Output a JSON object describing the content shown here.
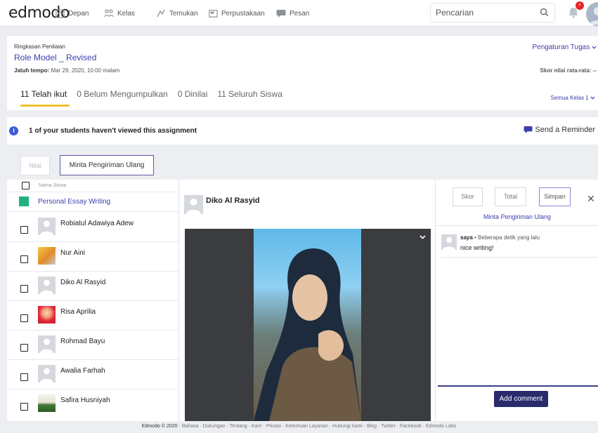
{
  "nav": {
    "logo": "edmodo",
    "links": [
      "Depan",
      "Kelas",
      "Temukan",
      "Perpustakaan",
      "Pesan"
    ],
    "search_placeholder": "Pencarian",
    "notification_count": "•"
  },
  "assignment": {
    "summary_label": "Ringkasan Penilaian",
    "title": "Role Model _ Revised",
    "due_label": "Jatuh tempo:",
    "due_value": "Mar 29, 2020, 10:00 malam",
    "settings_link": "Pengaturan Tugas",
    "avg_label": "Skor nilai rata-rata: --",
    "tabs": [
      "11 Telah ikut",
      "0 Belum Mengumpulkan",
      "0 Dinilai",
      "11 Seluruh Siswa"
    ],
    "class_filter": "Semua Kelas 1"
  },
  "notice": {
    "message": "1 of your students haven't viewed this assignment",
    "reminder": "Send a Reminder"
  },
  "actions": {
    "grade": "Nilai",
    "request_resubmission": "Minta Pengiriman Ulang"
  },
  "students": {
    "header": "Nama Siswa",
    "group": "Personal Essay Writing",
    "rows": [
      {
        "name": "Robiatul Adawiya Adew",
        "avatar": "default"
      },
      {
        "name": "Nur Aini",
        "avatar": "photo-yellow"
      },
      {
        "name": "Diko Al Rasyid",
        "avatar": "default"
      },
      {
        "name": "Risa Aprilia",
        "avatar": "photo-red"
      },
      {
        "name": "Rohmad Bayu",
        "avatar": "default"
      },
      {
        "name": "Awalia Farhah",
        "avatar": "default"
      },
      {
        "name": "Safira Husniyah",
        "avatar": "photo-green"
      }
    ]
  },
  "viewer": {
    "student_name": "Diko Al Rasyid"
  },
  "grading": {
    "score": "Skor",
    "total": "Total",
    "save": "Simpan",
    "request_resubmission": "Minta Pengiriman Ulang",
    "comment_author": "saya",
    "comment_time": "Beberapa detik yang lalu",
    "comment_text": "nice writing!",
    "add_comment": "Add comment"
  },
  "footer": {
    "brand": "Edmodo © 2020",
    "links": "Bahasa · Dukungan · Tentang · Karir · Privasi · Ketentuan Layanan · Hubungi kami · Blog · Twitter · Facebook · Edmodo Labs"
  },
  "colors": {
    "accent": "#3d3db0",
    "tab_underline": "#f2c12e",
    "group_square": "#21b17f",
    "primary_button": "#2a2b6b",
    "badge": "#e3262c"
  }
}
